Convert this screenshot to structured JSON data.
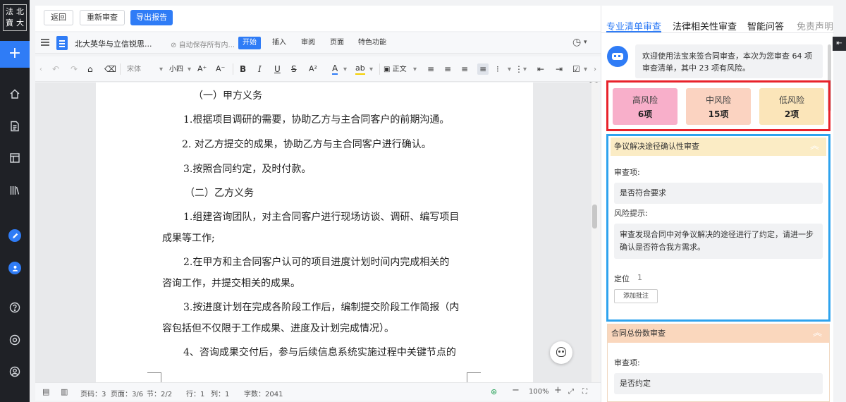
{
  "logo": {
    "chars": [
      "法",
      "北",
      "寶",
      "大"
    ]
  },
  "sidebar": {
    "add_label": "+",
    "icons": [
      "home-icon",
      "document-icon",
      "layout-icon",
      "library-icon",
      "pen-icon",
      "user-icon",
      "help-icon",
      "settings-icon",
      "account-icon"
    ]
  },
  "topbar": {
    "back": "返回",
    "rereview": "重新审查",
    "export": "导出报告"
  },
  "doc_header": {
    "title": "北大英华与立信锐思...",
    "autosave": "自动保存所有内...",
    "tabs": [
      "开始",
      "插入",
      "审阅",
      "页面",
      "特色功能"
    ]
  },
  "toolbar": {
    "font": "宋体",
    "size": "小四",
    "style": "正文"
  },
  "document": {
    "paragraphs": [
      "（一）甲方义务",
      "1.根据项目调研的需要，协助乙方与主合同客户的前期沟通。",
      "2. 对乙方提交的成果，协助乙方与主合同客户进行确认。",
      "3.按照合同约定，及时付款。",
      "（二）乙方义务",
      "1.组建咨询团队，对主合同客户进行现场访谈、调研、编写项目",
      "成果等工作;",
      "2.在甲方和主合同客户认可的项目进度计划时间内完成相关的",
      "咨询工作，并提交相关的成果。",
      "3.按进度计划在完成各阶段工作后，编制提交阶段工作简报（内",
      "容包括但不仅限于工作成果、进度及计划完成情况）。",
      "4、咨询成果交付后，参与后续信息系统实施过程中关键节点的"
    ]
  },
  "statusbar": {
    "page_code": "页码：3",
    "pages": "页面：3/6",
    "section": "节：2/2",
    "row": "行：1",
    "col": "列：1",
    "word_count": "字数：2041",
    "zoom": "100%"
  },
  "panel": {
    "tabs": [
      "专业清单审查",
      "法律相关性审查",
      "智能问答",
      "免责声明"
    ],
    "welcome": "欢迎使用法宝来签合同审查，本次为您审查 64 项审查清单，其中 23 项有风险。",
    "risks": [
      {
        "label": "高风险",
        "value": "6项",
        "color": "#f8afca"
      },
      {
        "label": "中风险",
        "value": "15项",
        "color": "#fbd3c1"
      },
      {
        "label": "低风险",
        "value": "2项",
        "color": "#fbe5b9"
      }
    ],
    "section1": {
      "title": "争议解决途径确认性审查",
      "review_label": "审查项:",
      "review_value": "是否符合要求",
      "tip_label": "风险提示:",
      "tip_value": "审查发现合同中对争议解决的途径进行了约定，请进一步确认是否符合我方需求。",
      "locate_label": "定位",
      "locate_value": "1",
      "add_note": "添加批注"
    },
    "section2": {
      "title": "合同总份数审查",
      "review_label": "审查项:",
      "review_value": "是否约定"
    }
  }
}
